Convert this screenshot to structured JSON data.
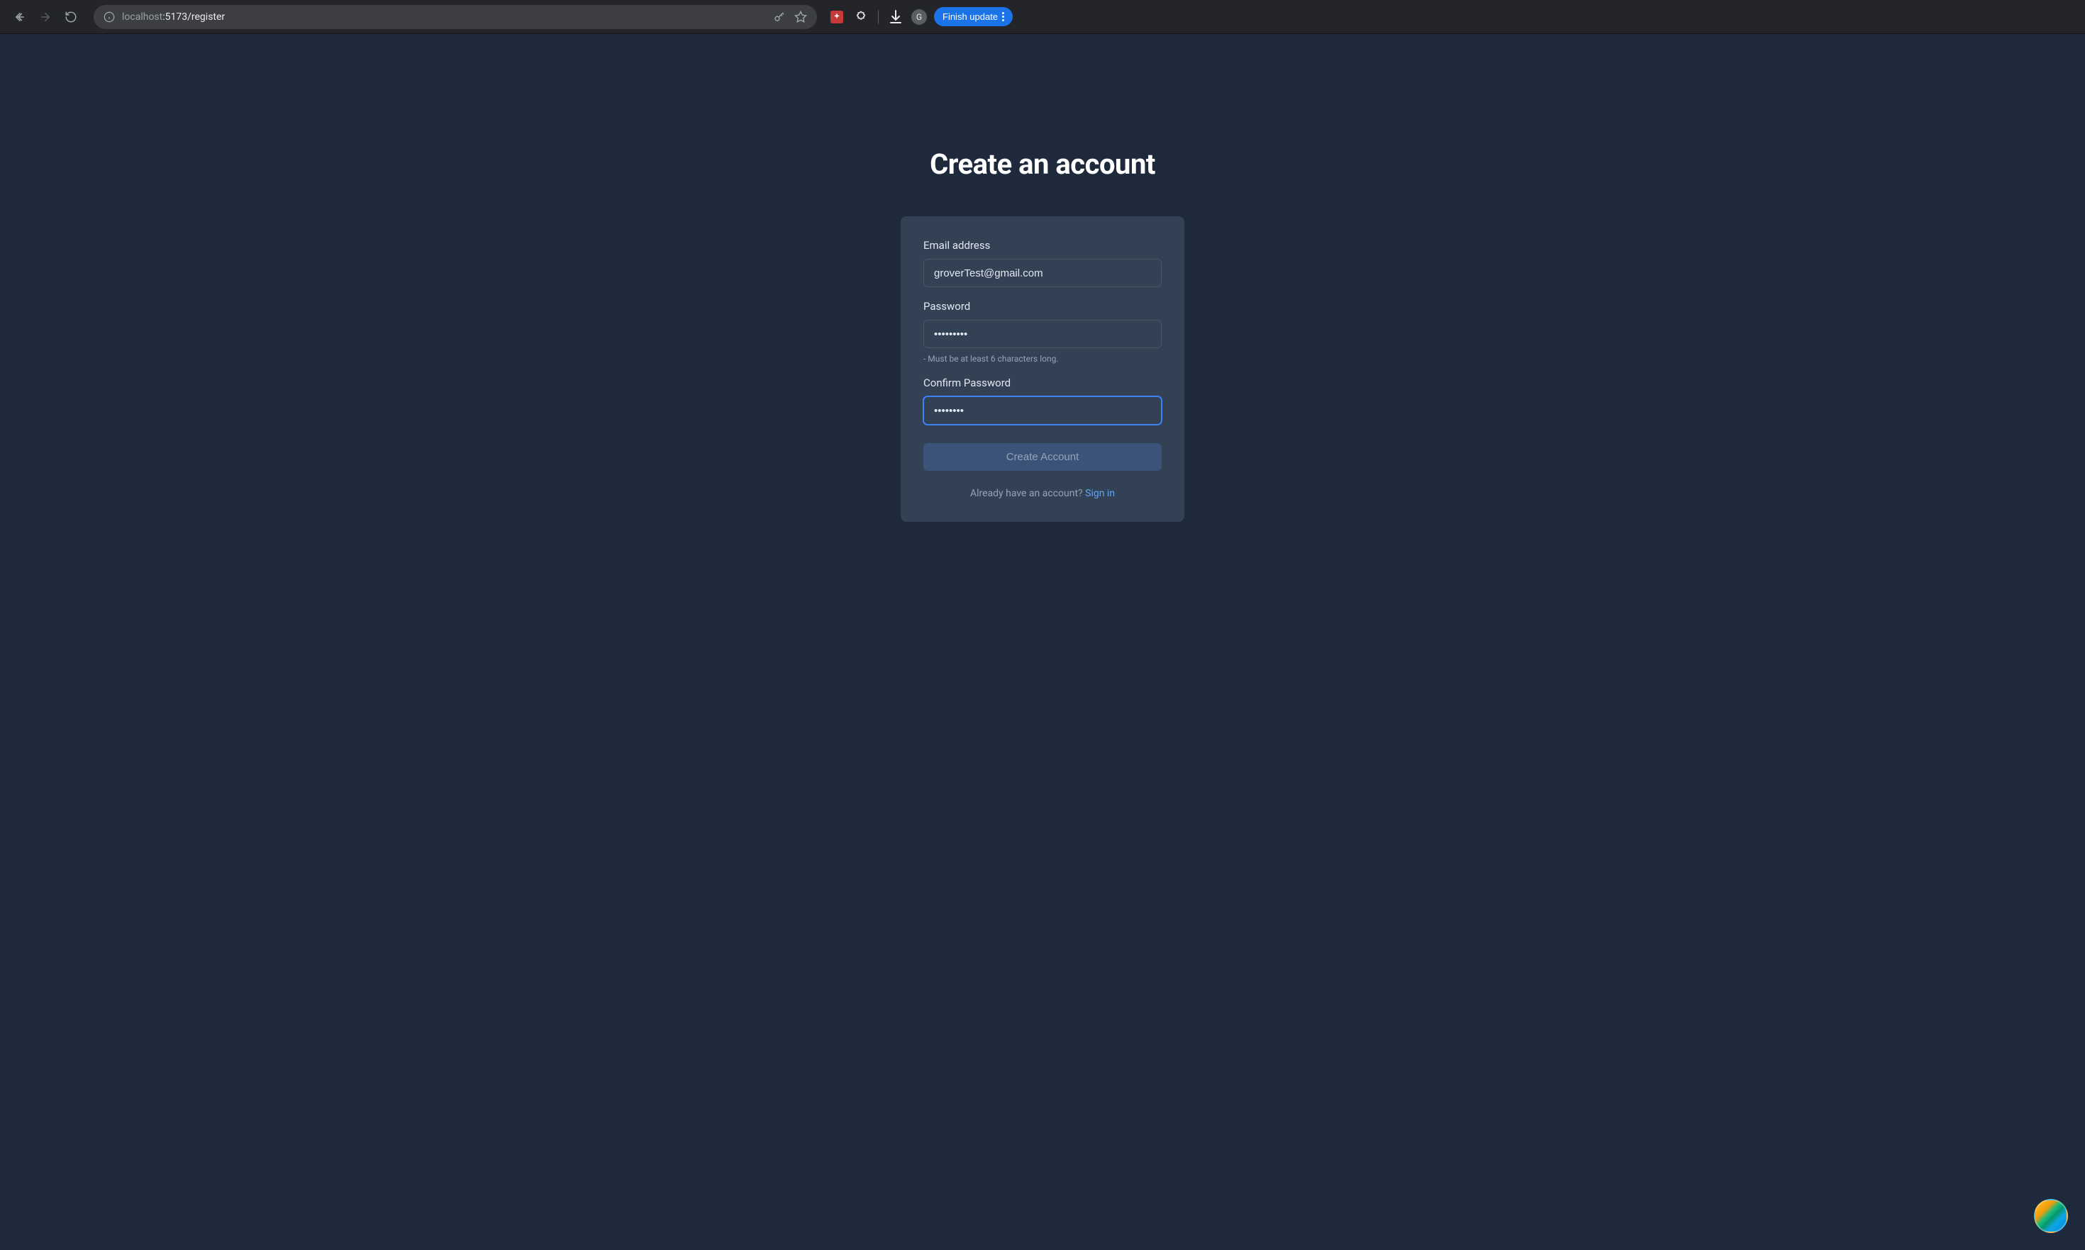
{
  "browser": {
    "url_host": "localhost",
    "url_path": ":5173/register",
    "avatar_letter": "G",
    "update_button": "Finish update"
  },
  "page": {
    "title": "Create an account"
  },
  "form": {
    "email": {
      "label": "Email address",
      "value": "groverTest@gmail.com"
    },
    "password": {
      "label": "Password",
      "value": "•••••••••",
      "helper": "- Must be at least 6 characters long."
    },
    "confirm_password": {
      "label": "Confirm Password",
      "value": "••••••••"
    },
    "submit_label": "Create Account",
    "signin_prompt": "Already have an account? ",
    "signin_link": "Sign in"
  }
}
